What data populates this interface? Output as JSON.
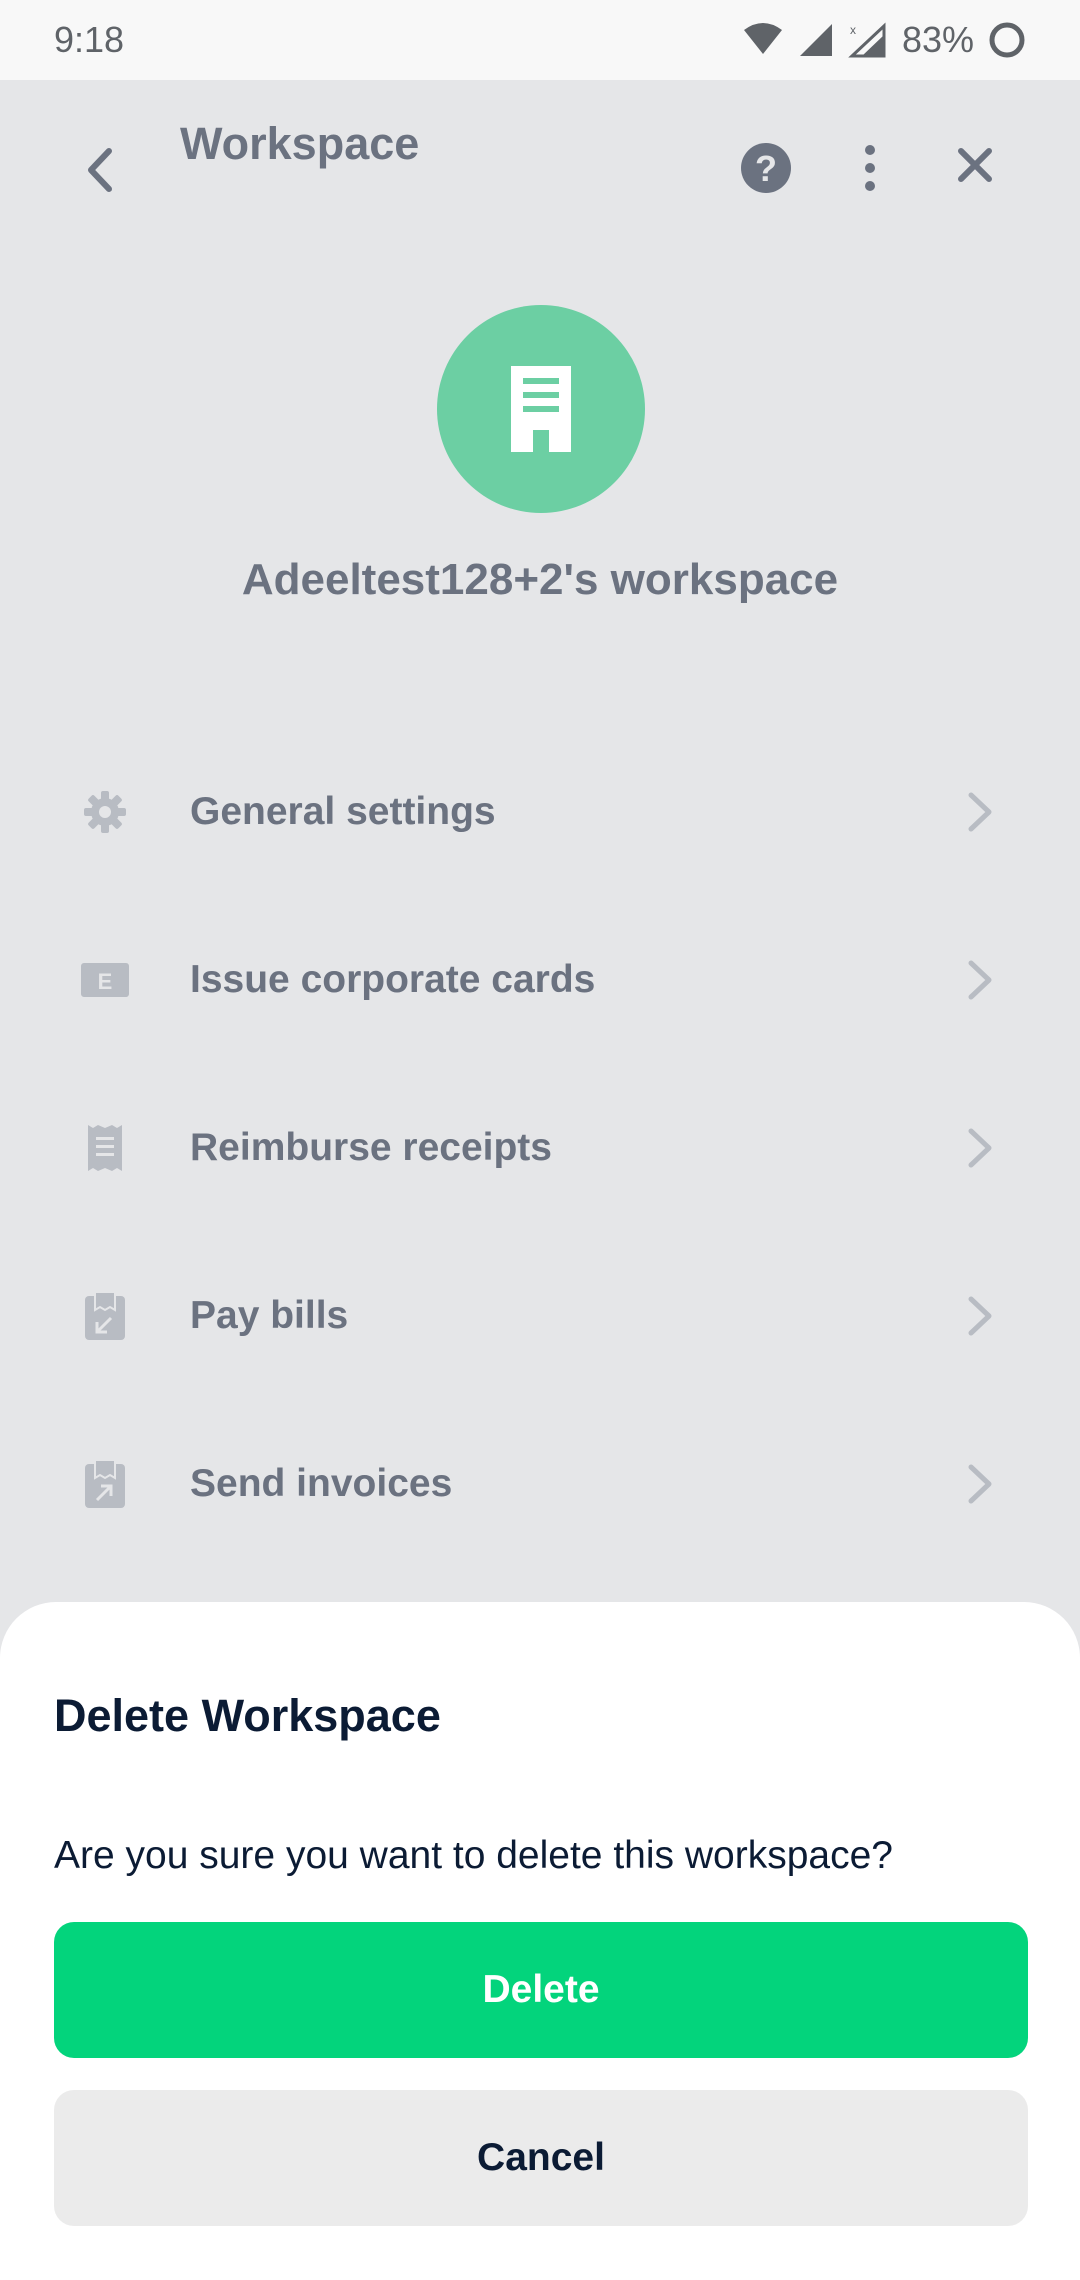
{
  "status_bar": {
    "time": "9:18",
    "battery": "83%"
  },
  "header": {
    "title": "Workspace",
    "icons": [
      "back-arrow-icon",
      "help-icon",
      "more-vertical-icon",
      "close-icon"
    ]
  },
  "workspace": {
    "name": "Adeeltest128+2's workspace",
    "avatar_icon": "building-icon",
    "avatar_color": "#6ccfa3"
  },
  "menu": {
    "items": [
      {
        "label": "General settings",
        "icon": "gear-icon"
      },
      {
        "label": "Issue corporate cards",
        "icon": "card-icon"
      },
      {
        "label": "Reimburse receipts",
        "icon": "receipt-icon"
      },
      {
        "label": "Pay bills",
        "icon": "bill-icon"
      },
      {
        "label": "Send invoices",
        "icon": "invoice-icon"
      }
    ]
  },
  "dialog": {
    "title": "Delete Workspace",
    "message": "Are you sure you want to delete this workspace?",
    "confirm_label": "Delete",
    "cancel_label": "Cancel",
    "confirm_color": "#03d47c"
  }
}
